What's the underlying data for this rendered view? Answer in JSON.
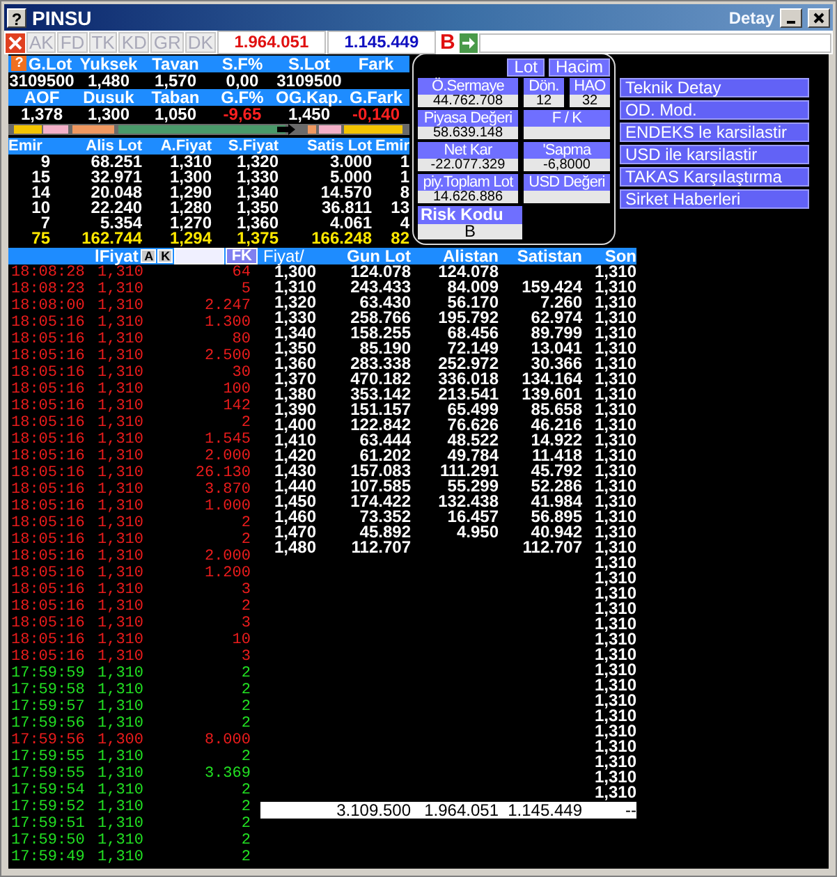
{
  "window": {
    "help_glyph": "?",
    "title": "PINSU",
    "subtitle": "Detay"
  },
  "toolbar": {
    "tabs": [
      {
        "label": "AK",
        "disabled": true
      },
      {
        "label": "FD",
        "disabled": true
      },
      {
        "label": "TK",
        "disabled": true
      },
      {
        "label": "KD",
        "disabled": true
      },
      {
        "label": "GR",
        "disabled": true
      },
      {
        "label": "DK",
        "disabled": true
      }
    ],
    "buy_total": "1.964.051",
    "sell_total": "1.145.449",
    "flag": "B"
  },
  "stats": {
    "help_glyph": "?",
    "rows": [
      [
        {
          "label": "G.Lot",
          "value": "3109500",
          "negative": false
        },
        {
          "label": "Yuksek",
          "value": "1,480",
          "negative": false
        },
        {
          "label": "Tavan",
          "value": "1,570",
          "negative": false
        },
        {
          "label": "S.F%",
          "value": "0,00",
          "negative": false
        },
        {
          "label": "S.Lot",
          "value": "3109500",
          "negative": false
        },
        {
          "label": "Fark"
        }
      ],
      [
        {
          "label": "AOF",
          "value": "1,378",
          "negative": false
        },
        {
          "label": "Dusuk",
          "value": "1,300",
          "negative": false
        },
        {
          "label": "Taban",
          "value": "1,050",
          "negative": false
        },
        {
          "label": "G.F%",
          "value": "-9,65",
          "negative": true
        },
        {
          "label": "OG.Kap.",
          "value": "1,450",
          "negative": false
        },
        {
          "label": "G.Fark",
          "value": "-0,140",
          "negative": true
        }
      ]
    ]
  },
  "order_book": {
    "columns": [
      "Emir",
      "Alis Lot",
      "A.Fiyat",
      "S.Fiyat",
      "Satis Lot",
      "Emir"
    ],
    "rows": [
      {
        "kind": "level",
        "cells": [
          "9",
          "68.251",
          "1,310",
          "1,320",
          "3.000",
          "1"
        ]
      },
      {
        "kind": "level",
        "cells": [
          "15",
          "32.971",
          "1,300",
          "1,330",
          "5.000",
          "1"
        ]
      },
      {
        "kind": "level",
        "cells": [
          "14",
          "20.048",
          "1,290",
          "1,340",
          "14.570",
          "8"
        ]
      },
      {
        "kind": "level",
        "cells": [
          "10",
          "22.240",
          "1,280",
          "1,350",
          "36.811",
          "13"
        ]
      },
      {
        "kind": "level",
        "cells": [
          "7",
          "5.354",
          "1,270",
          "1,360",
          "4.061",
          "4"
        ]
      },
      {
        "kind": "total",
        "cells": [
          "75",
          "162.744",
          "1,294",
          "1,375",
          "166.248",
          "82"
        ]
      }
    ]
  },
  "detail": {
    "toggles": [
      "Lot",
      "Hacim"
    ],
    "fields": [
      {
        "kind": "single",
        "label": "Ö.Sermaye",
        "value": "44.762.708"
      },
      {
        "kind": "single",
        "label": "Dön.",
        "value": "12"
      },
      {
        "kind": "single",
        "label": "HAO",
        "value": "32"
      },
      {
        "kind": "single",
        "label": "Piyasa Değeri",
        "value": "58.639.148"
      },
      {
        "kind": "double",
        "label": "F / K"
      },
      {
        "kind": "single",
        "label": "Net Kar",
        "value": "-22.077.329"
      },
      {
        "kind": "double",
        "label": "'Sapma",
        "value": "-6,8000"
      },
      {
        "kind": "single",
        "label": "piy.Toplam Lot",
        "value": "14.626.886"
      },
      {
        "kind": "double",
        "label": "USD Değeri"
      }
    ],
    "risk": {
      "label": "Risk Kodu",
      "value": "B"
    }
  },
  "links": [
    "Teknik Detay",
    "OD. Mod.",
    "ENDEKS le karsilastir",
    "USD ile karsilastir",
    "TAKAS Karşılaştırma",
    "Sirket Haberleri"
  ],
  "trades": {
    "header": "lFiyat",
    "buttons": [
      "A",
      "K"
    ],
    "filter_button": "FK",
    "rows": [
      {
        "time": "18:08:28",
        "price": "1,310",
        "lot": "64",
        "rising": false
      },
      {
        "time": "18:08:23",
        "price": "1,310",
        "lot": "5",
        "rising": false
      },
      {
        "time": "18:08:00",
        "price": "1,310",
        "lot": "2.247",
        "rising": false
      },
      {
        "time": "18:05:16",
        "price": "1,310",
        "lot": "1.300",
        "rising": false
      },
      {
        "time": "18:05:16",
        "price": "1,310",
        "lot": "80",
        "rising": false
      },
      {
        "time": "18:05:16",
        "price": "1,310",
        "lot": "2.500",
        "rising": false
      },
      {
        "time": "18:05:16",
        "price": "1,310",
        "lot": "30",
        "rising": false
      },
      {
        "time": "18:05:16",
        "price": "1,310",
        "lot": "100",
        "rising": false
      },
      {
        "time": "18:05:16",
        "price": "1,310",
        "lot": "142",
        "rising": false
      },
      {
        "time": "18:05:16",
        "price": "1,310",
        "lot": "2",
        "rising": false
      },
      {
        "time": "18:05:16",
        "price": "1,310",
        "lot": "1.545",
        "rising": false
      },
      {
        "time": "18:05:16",
        "price": "1,310",
        "lot": "2.000",
        "rising": false
      },
      {
        "time": "18:05:16",
        "price": "1,310",
        "lot": "26.130",
        "rising": false
      },
      {
        "time": "18:05:16",
        "price": "1,310",
        "lot": "3.870",
        "rising": false
      },
      {
        "time": "18:05:16",
        "price": "1,310",
        "lot": "1.000",
        "rising": false
      },
      {
        "time": "18:05:16",
        "price": "1,310",
        "lot": "2",
        "rising": false
      },
      {
        "time": "18:05:16",
        "price": "1,310",
        "lot": "2",
        "rising": false
      },
      {
        "time": "18:05:16",
        "price": "1,310",
        "lot": "2.000",
        "rising": false
      },
      {
        "time": "18:05:16",
        "price": "1,310",
        "lot": "1.200",
        "rising": false
      },
      {
        "time": "18:05:16",
        "price": "1,310",
        "lot": "3",
        "rising": false
      },
      {
        "time": "18:05:16",
        "price": "1,310",
        "lot": "2",
        "rising": false
      },
      {
        "time": "18:05:16",
        "price": "1,310",
        "lot": "3",
        "rising": false
      },
      {
        "time": "18:05:16",
        "price": "1,310",
        "lot": "10",
        "rising": false
      },
      {
        "time": "18:05:16",
        "price": "1,310",
        "lot": "3",
        "rising": false
      },
      {
        "time": "17:59:59",
        "price": "1,310",
        "lot": "2",
        "rising": true
      },
      {
        "time": "17:59:58",
        "price": "1,310",
        "lot": "2",
        "rising": true
      },
      {
        "time": "17:59:57",
        "price": "1,310",
        "lot": "2",
        "rising": true
      },
      {
        "time": "17:59:56",
        "price": "1,310",
        "lot": "2",
        "rising": true
      },
      {
        "time": "17:59:56",
        "price": "1,300",
        "lot": "8.000",
        "rising": false
      },
      {
        "time": "17:59:55",
        "price": "1,310",
        "lot": "2",
        "rising": true
      },
      {
        "time": "17:59:55",
        "price": "1,310",
        "lot": "3.369",
        "rising": true
      },
      {
        "time": "17:59:54",
        "price": "1,310",
        "lot": "2",
        "rising": true
      },
      {
        "time": "17:59:52",
        "price": "1,310",
        "lot": "2",
        "rising": true
      },
      {
        "time": "17:59:51",
        "price": "1,310",
        "lot": "2",
        "rising": true
      },
      {
        "time": "17:59:50",
        "price": "1,310",
        "lot": "2",
        "rising": true
      },
      {
        "time": "17:59:49",
        "price": "1,310",
        "lot": "2",
        "rising": true
      }
    ]
  },
  "price_table": {
    "columns": [
      "Fiyat/",
      "Gun Lot",
      "Alistan",
      "Satistan",
      "Son"
    ],
    "rows": [
      {
        "fiyat": "1,300",
        "gun_lot": "124.078",
        "alistan": "124.078",
        "son": "1,310"
      },
      {
        "fiyat": "1,310",
        "gun_lot": "243.433",
        "alistan": "84.009",
        "satistan": "159.424",
        "son": "1,310"
      },
      {
        "fiyat": "1,320",
        "gun_lot": "63.430",
        "alistan": "56.170",
        "satistan": "7.260",
        "son": "1,310"
      },
      {
        "fiyat": "1,330",
        "gun_lot": "258.766",
        "alistan": "195.792",
        "satistan": "62.974",
        "son": "1,310"
      },
      {
        "fiyat": "1,340",
        "gun_lot": "158.255",
        "alistan": "68.456",
        "satistan": "89.799",
        "son": "1,310"
      },
      {
        "fiyat": "1,350",
        "gun_lot": "85.190",
        "alistan": "72.149",
        "satistan": "13.041",
        "son": "1,310"
      },
      {
        "fiyat": "1,360",
        "gun_lot": "283.338",
        "alistan": "252.972",
        "satistan": "30.366",
        "son": "1,310"
      },
      {
        "fiyat": "1,370",
        "gun_lot": "470.182",
        "alistan": "336.018",
        "satistan": "134.164",
        "son": "1,310"
      },
      {
        "fiyat": "1,380",
        "gun_lot": "353.142",
        "alistan": "213.541",
        "satistan": "139.601",
        "son": "1,310"
      },
      {
        "fiyat": "1,390",
        "gun_lot": "151.157",
        "alistan": "65.499",
        "satistan": "85.658",
        "son": "1,310"
      },
      {
        "fiyat": "1,400",
        "gun_lot": "122.842",
        "alistan": "76.626",
        "satistan": "46.216",
        "son": "1,310"
      },
      {
        "fiyat": "1,410",
        "gun_lot": "63.444",
        "alistan": "48.522",
        "satistan": "14.922",
        "son": "1,310"
      },
      {
        "fiyat": "1,420",
        "gun_lot": "61.202",
        "alistan": "49.784",
        "satistan": "11.418",
        "son": "1,310"
      },
      {
        "fiyat": "1,430",
        "gun_lot": "157.083",
        "alistan": "111.291",
        "satistan": "45.792",
        "son": "1,310"
      },
      {
        "fiyat": "1,440",
        "gun_lot": "107.585",
        "alistan": "55.299",
        "satistan": "52.286",
        "son": "1,310"
      },
      {
        "fiyat": "1,450",
        "gun_lot": "174.422",
        "alistan": "132.438",
        "satistan": "41.984",
        "son": "1,310"
      },
      {
        "fiyat": "1,460",
        "gun_lot": "73.352",
        "alistan": "16.457",
        "satistan": "56.895",
        "son": "1,310"
      },
      {
        "fiyat": "1,470",
        "gun_lot": "45.892",
        "alistan": "4.950",
        "satistan": "40.942",
        "son": "1,310"
      },
      {
        "fiyat": "1,480",
        "gun_lot": "112.707",
        "satistan": "112.707",
        "son": "1,310"
      },
      {
        "son": "1,310"
      },
      {
        "son": "1,310"
      },
      {
        "son": "1,310"
      },
      {
        "son": "1,310"
      },
      {
        "son": "1,310"
      },
      {
        "son": "1,310"
      },
      {
        "son": "1,310"
      },
      {
        "son": "1,310"
      },
      {
        "son": "1,310"
      },
      {
        "son": "1,310"
      },
      {
        "son": "1,310"
      },
      {
        "son": "1,310"
      },
      {
        "son": "1,310"
      },
      {
        "son": "1,310"
      },
      {
        "son": "1,310"
      },
      {
        "son": "1,310"
      }
    ],
    "totals": {
      "gun_lot": "3.109.500",
      "alistan": "1.964.051",
      "satistan": "1.145.449",
      "son": "--"
    }
  }
}
